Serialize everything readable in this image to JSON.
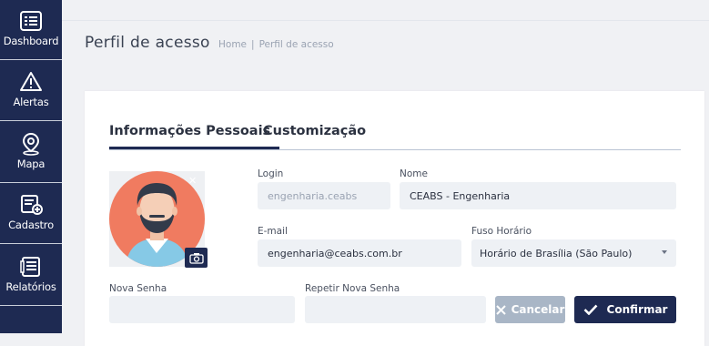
{
  "sidebar": {
    "items": [
      {
        "label": "Dashboard",
        "icon": "dashboard-icon"
      },
      {
        "label": "Alertas",
        "icon": "warning-icon"
      },
      {
        "label": "Mapa",
        "icon": "map-pin-icon"
      },
      {
        "label": "Cadastro",
        "icon": "register-icon"
      },
      {
        "label": "Relatórios",
        "icon": "reports-icon"
      }
    ]
  },
  "header": {
    "title": "Perfil de acesso",
    "breadcrumb": {
      "home": "Home",
      "separator": "|",
      "current": "Perfil de acesso"
    }
  },
  "tabs": [
    {
      "label": "Informações Pessoais",
      "active": true
    },
    {
      "label": "Customização",
      "active": false
    }
  ],
  "form": {
    "login": {
      "label": "Login",
      "value": "engenharia.ceabs"
    },
    "nome": {
      "label": "Nome",
      "value": "CEABS - Engenharia"
    },
    "email": {
      "label": "E-mail",
      "value": "engenharia@ceabs.com.br"
    },
    "fuso": {
      "label": "Fuso Horário",
      "value": "Horário de Brasília (São Paulo)"
    },
    "nova_senha": {
      "label": "Nova Senha",
      "value": ""
    },
    "repetir_senha": {
      "label": "Repetir Nova Senha",
      "value": ""
    }
  },
  "buttons": {
    "cancel": "Cancelar",
    "confirm": "Confirmar"
  },
  "colors": {
    "navy": "#1e2a52",
    "avatar_bg": "#f07b60",
    "input_bg": "#eef1f5",
    "cancel_bg": "#a9b6c6"
  }
}
